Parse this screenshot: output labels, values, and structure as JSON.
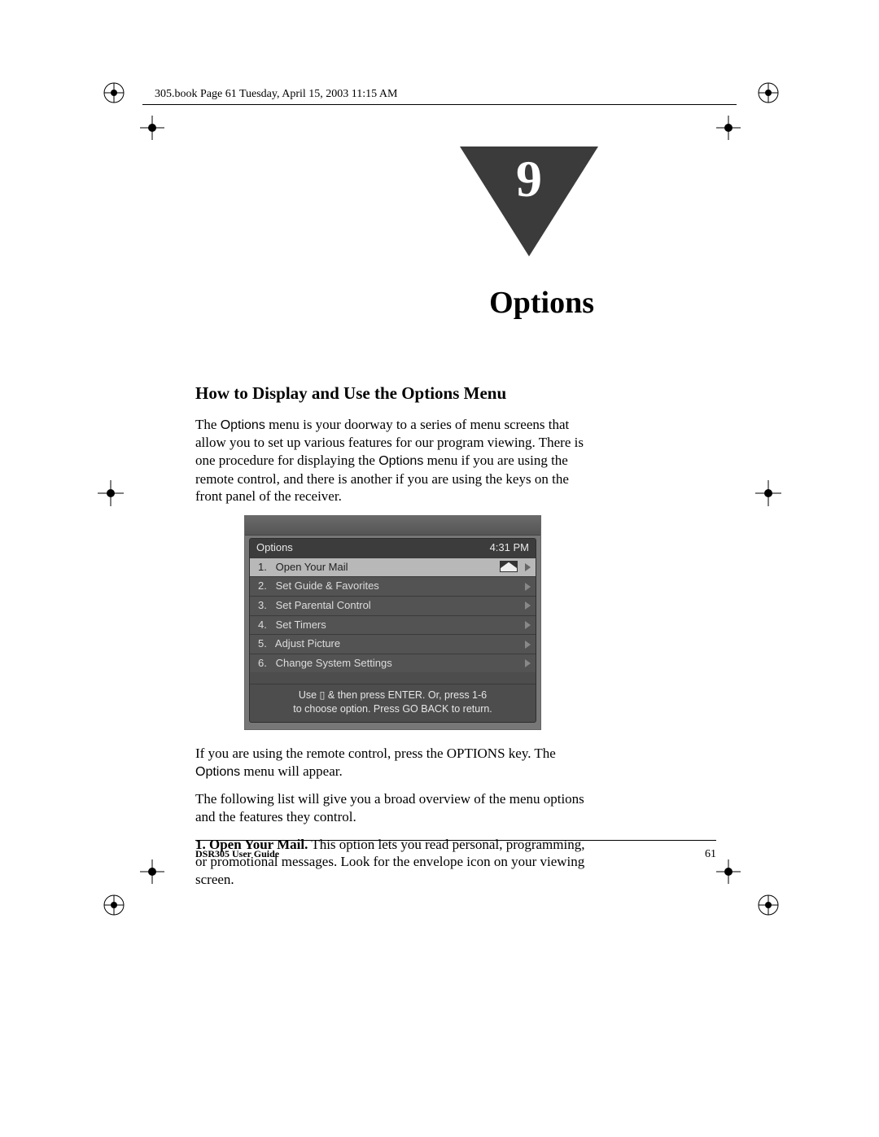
{
  "header": {
    "crop_text": "305.book  Page 61  Tuesday, April 15, 2003  11:15 AM"
  },
  "chapter": {
    "number": "9",
    "title": "Options"
  },
  "section": {
    "title": "How to Display and Use the Options Menu",
    "intro_before1": "The ",
    "intro_sans1": "Options",
    "intro_mid1": " menu is your doorway to a series of menu screens that allow you to set up various features for our program viewing. There is one procedure for displaying the ",
    "intro_sans2": "Options",
    "intro_after1": " menu if you are using the remote control, and there is another if you are using the keys on the front panel of the receiver.",
    "after_shot_before": "If you are using the remote control, press the OPTIONS key. The ",
    "after_shot_sans": "Options",
    "after_shot_after": " menu will appear.",
    "overview": "The following list will give you a broad overview of the menu options and the features they control.",
    "item1_lead": "1. Open Your Mail.",
    "item1_body": " This option lets you read personal, programming, or promotional messages. Look for the envelope icon on your viewing screen."
  },
  "screenshot": {
    "title": "Options",
    "time": "4:31 PM",
    "items": [
      {
        "n": "1.",
        "label": "Open Your Mail"
      },
      {
        "n": "2.",
        "label": "Set Guide & Favorites"
      },
      {
        "n": "3.",
        "label": "Set Parental Control"
      },
      {
        "n": "4.",
        "label": "Set Timers"
      },
      {
        "n": "5.",
        "label": "Adjust Picture"
      },
      {
        "n": "6.",
        "label": "Change System Settings"
      }
    ],
    "hint_line1": "Use ▯ & then press ENTER.  Or, press 1-6",
    "hint_line2": "to choose option.  Press GO BACK to return."
  },
  "footer": {
    "guide": "DSR305 User Guide",
    "page": "61"
  }
}
